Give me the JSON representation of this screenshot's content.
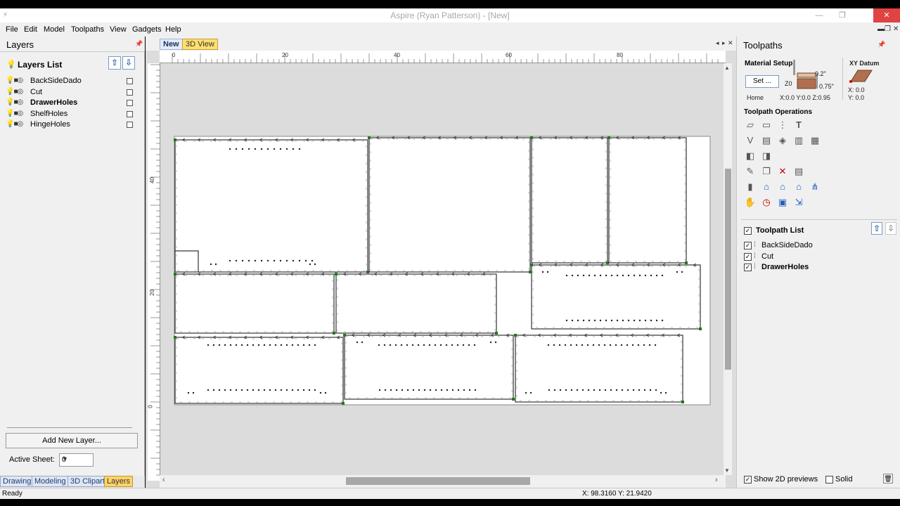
{
  "window": {
    "title": "Aspire (Ryan Patterson) - [New]"
  },
  "menu": [
    "File",
    "Edit",
    "Model",
    "Toolpaths",
    "View",
    "Gadgets",
    "Help"
  ],
  "layers_panel": {
    "header": "Layers",
    "list_title": "Layers List",
    "layers": [
      {
        "name": "BackSideDado",
        "bold": false
      },
      {
        "name": "Cut",
        "bold": false
      },
      {
        "name": "DrawerHoles",
        "bold": true
      },
      {
        "name": "ShelfHoles",
        "bold": false
      },
      {
        "name": "HingeHoles",
        "bold": false
      }
    ],
    "add_button": "Add New Layer...",
    "active_sheet_label": "Active Sheet:",
    "active_sheet_value": "0",
    "tabs": [
      "Drawing",
      "Modeling",
      "3D Clipart",
      "Layers"
    ],
    "active_tab": "Layers"
  },
  "view_tabs": [
    "New",
    "3D View"
  ],
  "ruler": {
    "h_labels": [
      "0",
      "20",
      "40",
      "60",
      "80"
    ],
    "v_labels": [
      "0",
      "20",
      "40"
    ]
  },
  "toolpaths_panel": {
    "header": "Toolpaths",
    "material_setup": "Material Setup",
    "set_button": "Set ...",
    "z_top": "0.2\"",
    "z_thickness": "0.75\"",
    "z_label": "Z0",
    "home_label": "Home",
    "home_coords": "X:0.0 Y:0.0 Z:0.95",
    "xy_datum": "XY Datum",
    "datum_x": "X: 0.0",
    "datum_y": "Y: 0.0",
    "operations_title": "Toolpath Operations",
    "list_title": "Toolpath List",
    "toolpaths": [
      {
        "name": "BackSideDado",
        "checked": true,
        "bold": false
      },
      {
        "name": "Cut",
        "checked": true,
        "bold": false
      },
      {
        "name": "DrawerHoles",
        "checked": true,
        "bold": true
      }
    ],
    "show_2d_previews": "Show 2D previews",
    "show_2d_checked": true,
    "solid": "Solid",
    "solid_checked": false
  },
  "status": {
    "text": "Ready",
    "coords": "X: 98.3160 Y: 21.9420"
  },
  "colors": {
    "canvas_bg": "#dcdcdc",
    "sheet": "#ffffff",
    "vector_line": "#333333",
    "selected_node": "#1f7a1f",
    "active_tab": "#ffd36a"
  }
}
